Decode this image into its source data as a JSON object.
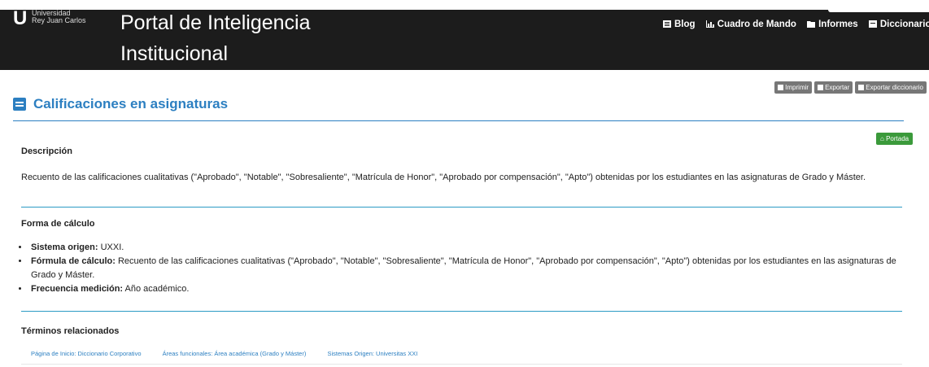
{
  "header": {
    "logo_letter": "U",
    "logo_line1": "Universidad",
    "logo_line2": "Rey Juan Carlos",
    "title": "Portal de Inteligencia Institucional",
    "nav": [
      {
        "label": "Blog",
        "icon": "newspaper-icon"
      },
      {
        "label": "Cuadro de Mando",
        "icon": "chart-icon"
      },
      {
        "label": "Informes",
        "icon": "folder-icon"
      },
      {
        "label": "Diccionario",
        "icon": "book-icon"
      }
    ]
  },
  "toolbar": {
    "print": "Imprimir",
    "export": "Exportar",
    "export_dict": "Exportar diccionario"
  },
  "page": {
    "title": "Calificaciones en asignaturas",
    "portada": "Portada"
  },
  "descripcion": {
    "heading": "Descripción",
    "text": "Recuento de las calificaciones cualitativas (\"Aprobado\", \"Notable\", \"Sobresaliente\", \"Matrícula de Honor\", \"Aprobado por compensación\", \"Apto\") obtenidas por los estudiantes en las asignaturas de Grado y Máster."
  },
  "calculo": {
    "heading": "Forma de cálculo",
    "items": [
      {
        "label": "Sistema origen:",
        "value": " UXXI."
      },
      {
        "label": "Fórmula de cálculo:",
        "value": " Recuento de las calificaciones cualitativas (\"Aprobado\", \"Notable\", \"Sobresaliente\", \"Matrícula de Honor\", \"Aprobado por compensación\", \"Apto\") obtenidas por los estudiantes en las asignaturas de Grado y Máster."
      },
      {
        "label": "Frecuencia medición:",
        "value": " Año académico."
      }
    ]
  },
  "terminos": {
    "heading": "Términos relacionados",
    "links": [
      "Página de Inicio: Diccionario Corporativo",
      "Áreas funcionales: Área académica (Grado y Máster)",
      "Sistemas Origen: Universitas XXI"
    ]
  },
  "colors": {
    "header_bg": "#1c1c1c",
    "accent": "#2c7fc1",
    "portada_green": "#3b9a3b"
  }
}
